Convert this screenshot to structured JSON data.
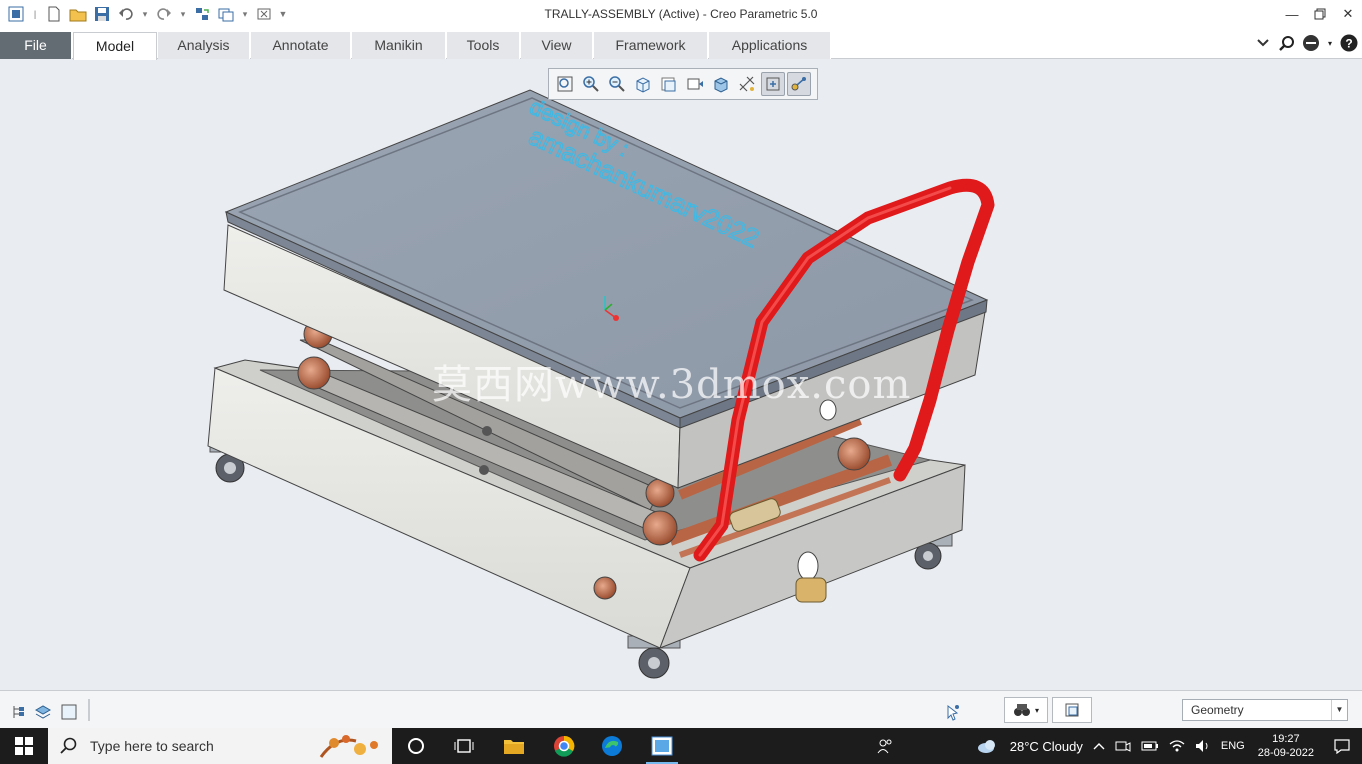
{
  "window": {
    "title": "TRALLY-ASSEMBLY (Active) - Creo Parametric 5.0",
    "controls": [
      "minimize-icon",
      "restore-icon",
      "close-icon"
    ]
  },
  "quick_access": [
    "app-icon",
    "new-icon",
    "open-icon",
    "save-icon",
    "undo-icon",
    "redo-icon",
    "regenerate-icon",
    "windows-icon",
    "close-window-icon",
    "customize-icon"
  ],
  "ribbon": {
    "tabs": [
      "File",
      "Model",
      "Analysis",
      "Annotate",
      "Manikin",
      "Tools",
      "View",
      "Framework",
      "Applications"
    ],
    "active_tab": "Model",
    "right_tools": [
      "collapse-ribbon-icon",
      "search-icon",
      "help-icon"
    ]
  },
  "graphics_toolbar": {
    "tools": [
      "refit-icon",
      "zoom-in-icon",
      "zoom-out-icon",
      "repaint-icon",
      "view-manager-icon",
      "saved-orientations-icon",
      "display-style-icon",
      "datum-display-icon",
      "spin-center-icon",
      "annotation-display-icon"
    ],
    "toggled": [
      "spin-center-icon",
      "annotation-display-icon"
    ]
  },
  "viewport": {
    "model_text_line1": "design by :",
    "model_text_line2": "amachankumarv2022",
    "watermark": "莫西网www.3dmox.com"
  },
  "statusbar": {
    "left_icons": [
      "model-tree-icon",
      "layers-icon",
      "show-hide-icon"
    ],
    "filter_label": "Geometry",
    "right_icons": [
      "smart-select-icon",
      "find-icon",
      "selection-box-icon"
    ]
  },
  "taskbar": {
    "search_placeholder": "Type here to search",
    "apps": [
      "cortana-icon",
      "task-view-icon",
      "file-explorer-icon",
      "chrome-icon",
      "edge-icon",
      "creo-icon"
    ],
    "weather": "28°C  Cloudy",
    "language": "ENG",
    "time": "19:27",
    "date": "28-09-2022"
  },
  "colors": {
    "file_tab": "#636b73",
    "handle": "#e0191b",
    "platform_top": "#949fad",
    "frame": "#e7e7e4",
    "roller": "#b86545",
    "model_text": "#3fb9e4"
  }
}
